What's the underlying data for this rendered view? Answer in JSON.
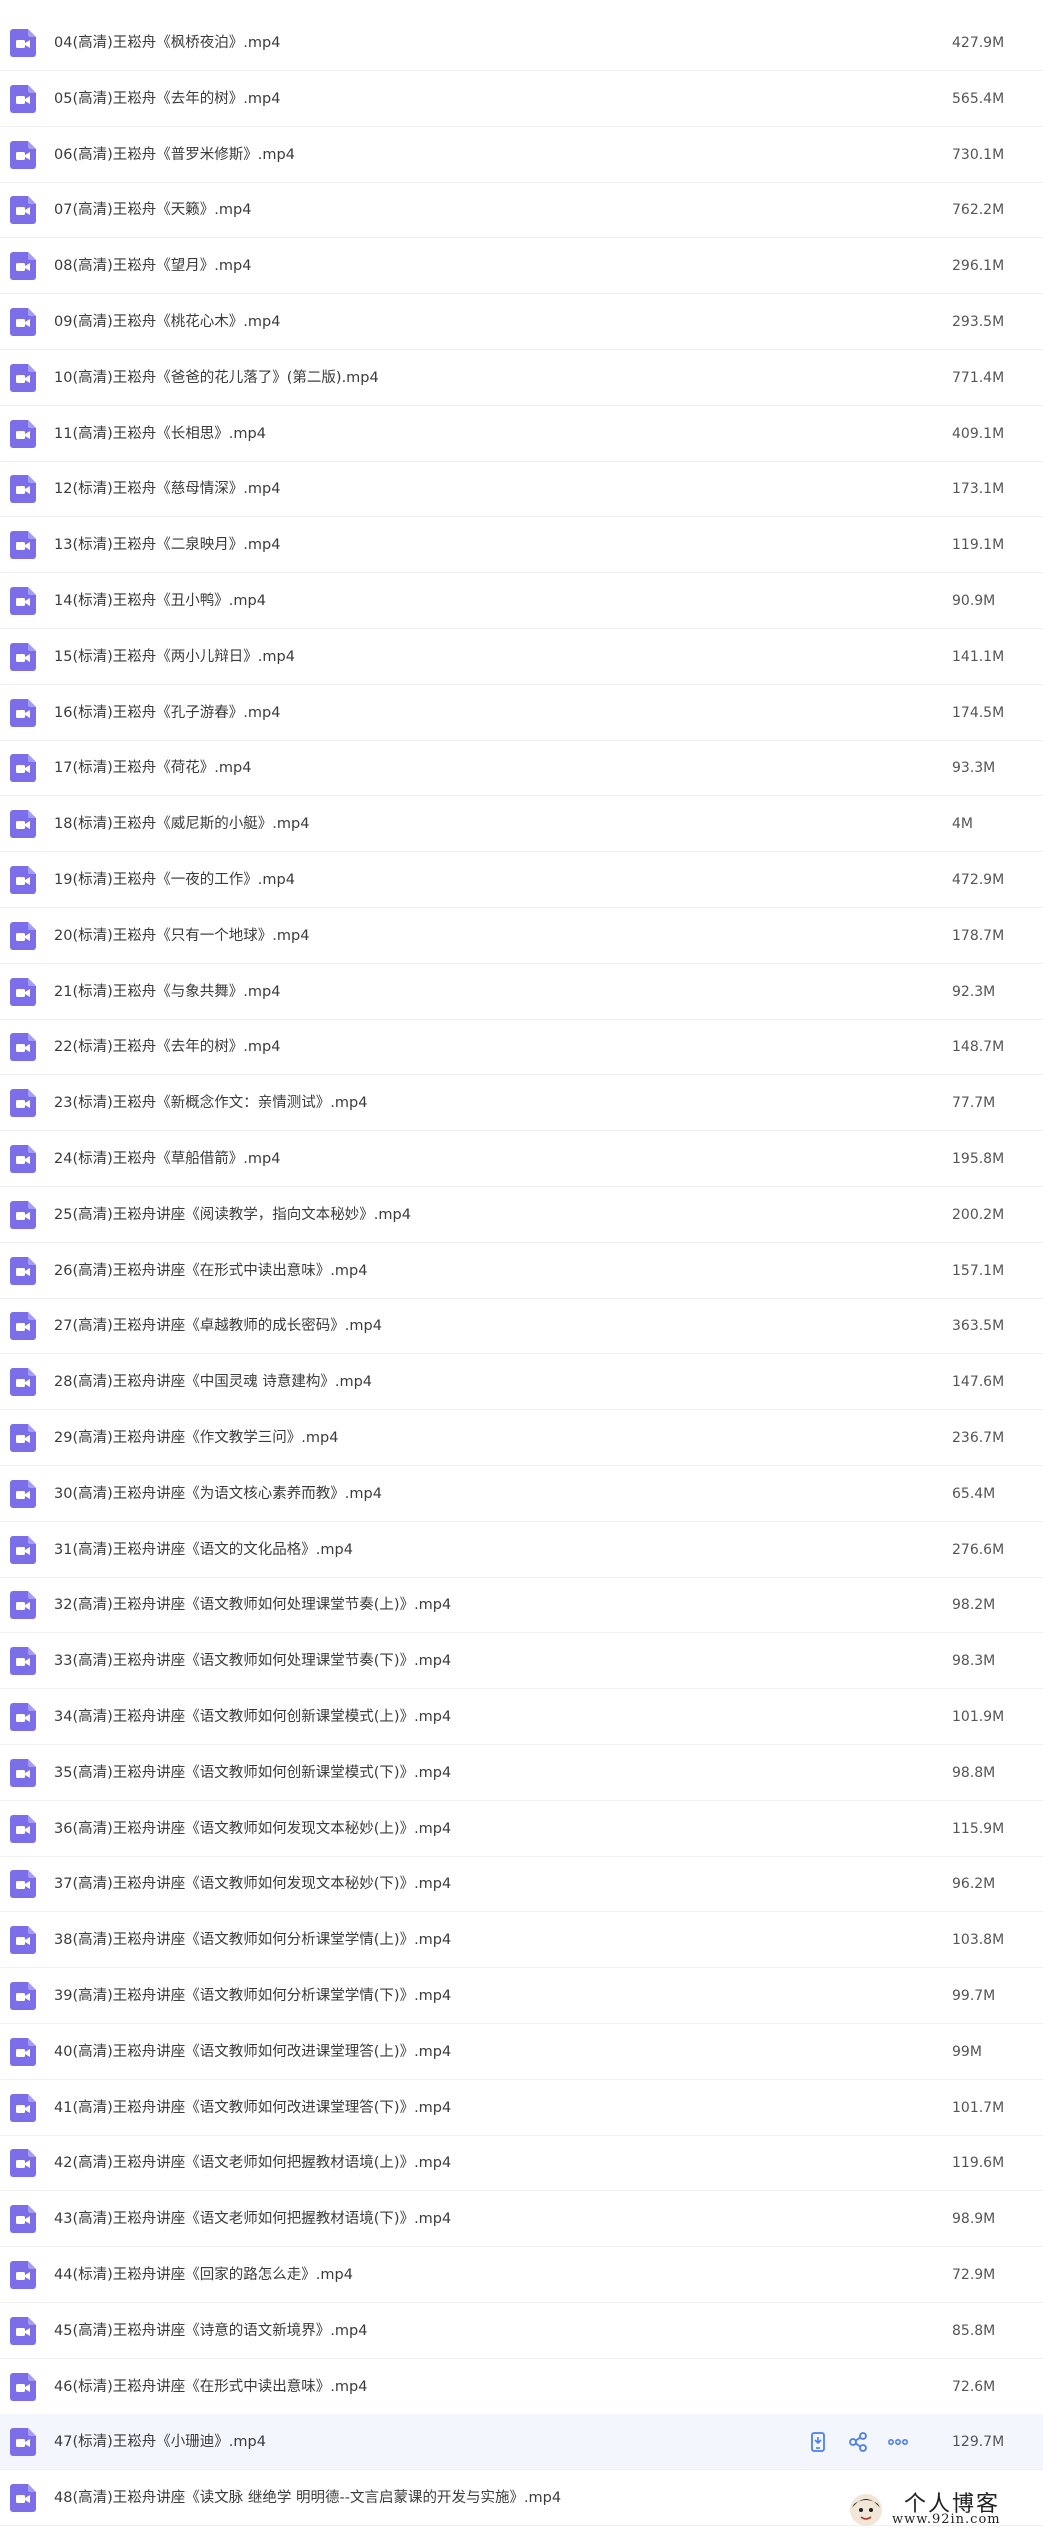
{
  "files": [
    {
      "name": "04(高清)王崧舟《枫桥夜泊》.mp4",
      "size": "427.9M",
      "type_icon": "video-file-icon"
    },
    {
      "name": "05(高清)王崧舟《去年的树》.mp4",
      "size": "565.4M",
      "type_icon": "video-file-icon"
    },
    {
      "name": "06(高清)王崧舟《普罗米修斯》.mp4",
      "size": "730.1M",
      "type_icon": "video-file-icon"
    },
    {
      "name": "07(高清)王崧舟《天籁》.mp4",
      "size": "762.2M",
      "type_icon": "video-file-icon"
    },
    {
      "name": "08(高清)王崧舟《望月》.mp4",
      "size": "296.1M",
      "type_icon": "video-file-icon"
    },
    {
      "name": "09(高清)王崧舟《桃花心木》.mp4",
      "size": "293.5M",
      "type_icon": "video-file-icon"
    },
    {
      "name": "10(高清)王崧舟《爸爸的花儿落了》(第二版).mp4",
      "size": "771.4M",
      "type_icon": "video-file-icon"
    },
    {
      "name": "11(高清)王崧舟《长相思》.mp4",
      "size": "409.1M",
      "type_icon": "video-file-icon"
    },
    {
      "name": "12(标清)王崧舟《慈母情深》.mp4",
      "size": "173.1M",
      "type_icon": "video-file-icon"
    },
    {
      "name": "13(标清)王崧舟《二泉映月》.mp4",
      "size": "119.1M",
      "type_icon": "video-file-icon"
    },
    {
      "name": "14(标清)王崧舟《丑小鸭》.mp4",
      "size": "90.9M",
      "type_icon": "video-file-icon"
    },
    {
      "name": "15(标清)王崧舟《两小儿辩日》.mp4",
      "size": "141.1M",
      "type_icon": "video-file-icon"
    },
    {
      "name": "16(标清)王崧舟《孔子游春》.mp4",
      "size": "174.5M",
      "type_icon": "video-file-icon"
    },
    {
      "name": "17(标清)王崧舟《荷花》.mp4",
      "size": "93.3M",
      "type_icon": "video-file-icon"
    },
    {
      "name": "18(标清)王崧舟《威尼斯的小艇》.mp4",
      "size": "4M",
      "type_icon": "video-file-icon"
    },
    {
      "name": "19(标清)王崧舟《一夜的工作》.mp4",
      "size": "472.9M",
      "type_icon": "video-file-icon"
    },
    {
      "name": "20(标清)王崧舟《只有一个地球》.mp4",
      "size": "178.7M",
      "type_icon": "video-file-icon"
    },
    {
      "name": "21(标清)王崧舟《与象共舞》.mp4",
      "size": "92.3M",
      "type_icon": "video-file-icon"
    },
    {
      "name": "22(标清)王崧舟《去年的树》.mp4",
      "size": "148.7M",
      "type_icon": "video-file-icon"
    },
    {
      "name": "23(标清)王崧舟《新概念作文：亲情测试》.mp4",
      "size": "77.7M",
      "type_icon": "video-file-icon"
    },
    {
      "name": "24(标清)王崧舟《草船借箭》.mp4",
      "size": "195.8M",
      "type_icon": "video-file-icon"
    },
    {
      "name": "25(高清)王崧舟讲座《阅读教学，指向文本秘妙》.mp4",
      "size": "200.2M",
      "type_icon": "video-file-icon"
    },
    {
      "name": "26(高清)王崧舟讲座《在形式中读出意味》.mp4",
      "size": "157.1M",
      "type_icon": "video-file-icon"
    },
    {
      "name": "27(高清)王崧舟讲座《卓越教师的成长密码》.mp4",
      "size": "363.5M",
      "type_icon": "video-file-icon"
    },
    {
      "name": "28(高清)王崧舟讲座《中国灵魂 诗意建构》.mp4",
      "size": "147.6M",
      "type_icon": "video-file-icon"
    },
    {
      "name": "29(高清)王崧舟讲座《作文教学三问》.mp4",
      "size": "236.7M",
      "type_icon": "video-file-icon"
    },
    {
      "name": "30(高清)王崧舟讲座《为语文核心素养而教》.mp4",
      "size": "65.4M",
      "type_icon": "video-file-icon"
    },
    {
      "name": "31(高清)王崧舟讲座《语文的文化品格》.mp4",
      "size": "276.6M",
      "type_icon": "video-file-icon"
    },
    {
      "name": "32(高清)王崧舟讲座《语文教师如何处理课堂节奏(上)》.mp4",
      "size": "98.2M",
      "type_icon": "video-file-icon"
    },
    {
      "name": "33(高清)王崧舟讲座《语文教师如何处理课堂节奏(下)》.mp4",
      "size": "98.3M",
      "type_icon": "video-file-icon"
    },
    {
      "name": "34(高清)王崧舟讲座《语文教师如何创新课堂模式(上)》.mp4",
      "size": "101.9M",
      "type_icon": "video-file-icon"
    },
    {
      "name": "35(高清)王崧舟讲座《语文教师如何创新课堂模式(下)》.mp4",
      "size": "98.8M",
      "type_icon": "video-file-icon"
    },
    {
      "name": "36(高清)王崧舟讲座《语文教师如何发现文本秘妙(上)》.mp4",
      "size": "115.9M",
      "type_icon": "video-file-icon"
    },
    {
      "name": "37(高清)王崧舟讲座《语文教师如何发现文本秘妙(下)》.mp4",
      "size": "96.2M",
      "type_icon": "video-file-icon"
    },
    {
      "name": "38(高清)王崧舟讲座《语文教师如何分析课堂学情(上)》.mp4",
      "size": "103.8M",
      "type_icon": "video-file-icon"
    },
    {
      "name": "39(高清)王崧舟讲座《语文教师如何分析课堂学情(下)》.mp4",
      "size": "99.7M",
      "type_icon": "video-file-icon"
    },
    {
      "name": "40(高清)王崧舟讲座《语文教师如何改进课堂理答(上)》.mp4",
      "size": "99M",
      "type_icon": "video-file-icon"
    },
    {
      "name": "41(高清)王崧舟讲座《语文教师如何改进课堂理答(下)》.mp4",
      "size": "101.7M",
      "type_icon": "video-file-icon"
    },
    {
      "name": "42(高清)王崧舟讲座《语文老师如何把握教材语境(上)》.mp4",
      "size": "119.6M",
      "type_icon": "video-file-icon"
    },
    {
      "name": "43(高清)王崧舟讲座《语文老师如何把握教材语境(下)》.mp4",
      "size": "98.9M",
      "type_icon": "video-file-icon"
    },
    {
      "name": "44(标清)王崧舟讲座《回家的路怎么走》.mp4",
      "size": "72.9M",
      "type_icon": "video-file-icon"
    },
    {
      "name": "45(高清)王崧舟讲座《诗意的语文新境界》.mp4",
      "size": "85.8M",
      "type_icon": "video-file-icon"
    },
    {
      "name": "46(标清)王崧舟讲座《在形式中读出意味》.mp4",
      "size": "72.6M",
      "type_icon": "video-file-icon"
    },
    {
      "name": "47(标清)王崧舟《小珊迪》.mp4",
      "size": "129.7M",
      "type_icon": "video-file-icon",
      "hovered": true
    },
    {
      "name": "48(高清)王崧舟讲座《读文脉 继绝学 明明德--文言启蒙课的开发与实施》.mp4",
      "size": "",
      "type_icon": "video-file-icon"
    }
  ],
  "row_actions": {
    "icons": [
      "phone-icon",
      "share-icon",
      "more-icon"
    ]
  },
  "colors": {
    "icon_purple": "#7b6ee8",
    "row_hover": "#f4f6fe",
    "action_blue": "#4a7ef0",
    "divider": "#f0f0f3"
  },
  "watermark": {
    "title": "个人博客",
    "url": "www.92in.com"
  }
}
